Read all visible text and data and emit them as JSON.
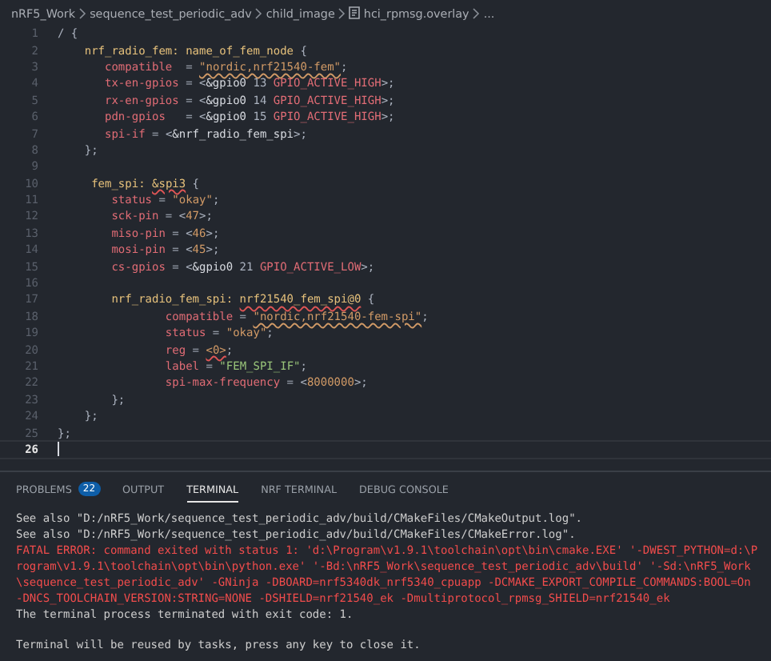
{
  "breadcrumb": [
    {
      "text": "nRF5_Work",
      "kind": "folder"
    },
    {
      "text": "sequence_test_periodic_adv",
      "kind": "folder"
    },
    {
      "text": "child_image",
      "kind": "folder"
    },
    {
      "text": "hci_rpmsg.overlay",
      "kind": "file"
    },
    {
      "text": "...",
      "kind": "more"
    }
  ],
  "editor": {
    "lines": [
      {
        "number": "1",
        "current": false,
        "tokens": [
          {
            "text": "/ {",
            "kind": "punct"
          }
        ]
      },
      {
        "number": "2",
        "current": false,
        "tokens": [
          {
            "text": "    nrf_radio_fem: name_of_fem_node",
            "kind": "node"
          },
          {
            "text": " {",
            "kind": "punct"
          }
        ]
      },
      {
        "number": "3",
        "current": false,
        "tokens": [
          {
            "text": "       compatible",
            "kind": "key"
          },
          {
            "text": "  = ",
            "kind": "punct"
          },
          {
            "text": "\"nordic,nrf21540-fem\"",
            "kind": "string",
            "warning": true
          },
          {
            "text": ";",
            "kind": "punct"
          }
        ]
      },
      {
        "number": "4",
        "current": false,
        "tokens": [
          {
            "text": "       tx-en-gpios",
            "kind": "key"
          },
          {
            "text": " = <",
            "kind": "punct"
          },
          {
            "text": "&gpio0",
            "kind": "ref"
          },
          {
            "text": " 13 ",
            "kind": "punct"
          },
          {
            "text": "GPIO_ACTIVE_HIGH",
            "kind": "const"
          },
          {
            "text": ">;",
            "kind": "punct"
          }
        ]
      },
      {
        "number": "5",
        "current": false,
        "tokens": [
          {
            "text": "       rx-en-gpios",
            "kind": "key"
          },
          {
            "text": " = <",
            "kind": "punct"
          },
          {
            "text": "&gpio0",
            "kind": "ref"
          },
          {
            "text": " 14 ",
            "kind": "punct"
          },
          {
            "text": "GPIO_ACTIVE_HIGH",
            "kind": "const"
          },
          {
            "text": ">;",
            "kind": "punct"
          }
        ]
      },
      {
        "number": "6",
        "current": false,
        "tokens": [
          {
            "text": "       pdn-gpios",
            "kind": "key"
          },
          {
            "text": "   = <",
            "kind": "punct"
          },
          {
            "text": "&gpio0",
            "kind": "ref"
          },
          {
            "text": " 15 ",
            "kind": "punct"
          },
          {
            "text": "GPIO_ACTIVE_HIGH",
            "kind": "const"
          },
          {
            "text": ">;",
            "kind": "punct"
          }
        ]
      },
      {
        "number": "7",
        "current": false,
        "tokens": [
          {
            "text": "       spi-if",
            "kind": "key"
          },
          {
            "text": " = <",
            "kind": "punct"
          },
          {
            "text": "&nrf_radio_fem_spi",
            "kind": "ref"
          },
          {
            "text": ">;",
            "kind": "punct"
          }
        ]
      },
      {
        "number": "8",
        "current": false,
        "tokens": [
          {
            "text": "    };",
            "kind": "punct"
          }
        ]
      },
      {
        "number": "9",
        "current": false
      },
      {
        "number": "10",
        "current": false,
        "tokens": [
          {
            "text": "     fem_spi: ",
            "kind": "node"
          },
          {
            "text": "&spi3",
            "kind": "node",
            "error": true
          },
          {
            "text": " {",
            "kind": "punct"
          }
        ]
      },
      {
        "number": "11",
        "current": false,
        "tokens": [
          {
            "text": "        status",
            "kind": "key"
          },
          {
            "text": " = ",
            "kind": "punct"
          },
          {
            "text": "\"okay\"",
            "kind": "string"
          },
          {
            "text": ";",
            "kind": "punct"
          }
        ]
      },
      {
        "number": "12",
        "current": false,
        "tokens": [
          {
            "text": "        sck-pin",
            "kind": "key"
          },
          {
            "text": " = <",
            "kind": "punct"
          },
          {
            "text": "47",
            "kind": "number"
          },
          {
            "text": ">;",
            "kind": "punct"
          }
        ]
      },
      {
        "number": "13",
        "current": false,
        "tokens": [
          {
            "text": "        miso-pin",
            "kind": "key"
          },
          {
            "text": " = <",
            "kind": "punct"
          },
          {
            "text": "46",
            "kind": "number"
          },
          {
            "text": ">;",
            "kind": "punct"
          }
        ]
      },
      {
        "number": "14",
        "current": false,
        "tokens": [
          {
            "text": "        mosi-pin",
            "kind": "key"
          },
          {
            "text": " = <",
            "kind": "punct"
          },
          {
            "text": "45",
            "kind": "number"
          },
          {
            "text": ">;",
            "kind": "punct"
          }
        ]
      },
      {
        "number": "15",
        "current": false,
        "tokens": [
          {
            "text": "        cs-gpios",
            "kind": "key"
          },
          {
            "text": " = <",
            "kind": "punct"
          },
          {
            "text": "&gpio0",
            "kind": "ref"
          },
          {
            "text": " 21 ",
            "kind": "punct"
          },
          {
            "text": "GPIO_ACTIVE_LOW",
            "kind": "const"
          },
          {
            "text": ">;",
            "kind": "punct"
          }
        ]
      },
      {
        "number": "16",
        "current": false
      },
      {
        "number": "17",
        "current": false,
        "tokens": [
          {
            "text": "        nrf_radio_fem_spi: ",
            "kind": "node"
          },
          {
            "text": "nrf21540_fem_spi@0",
            "kind": "node",
            "error": true
          },
          {
            "text": " {",
            "kind": "punct"
          }
        ]
      },
      {
        "number": "18",
        "current": false,
        "tokens": [
          {
            "text": "                compatible",
            "kind": "key"
          },
          {
            "text": " = ",
            "kind": "punct"
          },
          {
            "text": "\"nordic,nrf21540-fem-spi\"",
            "kind": "string",
            "warning": true
          },
          {
            "text": ";",
            "kind": "punct"
          }
        ]
      },
      {
        "number": "19",
        "current": false,
        "tokens": [
          {
            "text": "                status",
            "kind": "key"
          },
          {
            "text": " = ",
            "kind": "punct"
          },
          {
            "text": "\"okay\"",
            "kind": "string"
          },
          {
            "text": ";",
            "kind": "punct"
          }
        ]
      },
      {
        "number": "20",
        "current": false,
        "tokens": [
          {
            "text": "                reg",
            "kind": "key"
          },
          {
            "text": " = ",
            "kind": "punct"
          },
          {
            "text": "<0>",
            "kind": "number",
            "error": true
          },
          {
            "text": ";",
            "kind": "punct"
          }
        ]
      },
      {
        "number": "21",
        "current": false,
        "tokens": [
          {
            "text": "                label",
            "kind": "key"
          },
          {
            "text": " = ",
            "kind": "punct"
          },
          {
            "text": "\"FEM_SPI_IF\"",
            "kind": "label"
          },
          {
            "text": ";",
            "kind": "punct"
          }
        ]
      },
      {
        "number": "22",
        "current": false,
        "tokens": [
          {
            "text": "                spi-max-frequency",
            "kind": "key"
          },
          {
            "text": " = <",
            "kind": "punct"
          },
          {
            "text": "8000000",
            "kind": "number"
          },
          {
            "text": ">;",
            "kind": "punct"
          }
        ]
      },
      {
        "number": "23",
        "current": false,
        "tokens": [
          {
            "text": "        };",
            "kind": "punct"
          }
        ]
      },
      {
        "number": "24",
        "current": false,
        "tokens": [
          {
            "text": "    };",
            "kind": "punct"
          }
        ]
      },
      {
        "number": "25",
        "current": false,
        "tokens": [
          {
            "text": "};",
            "kind": "punct"
          }
        ]
      },
      {
        "number": "26",
        "current": true
      }
    ]
  },
  "panel": {
    "tabs": [
      {
        "label": "PROBLEMS",
        "badge": "22",
        "selected": false
      },
      {
        "label": "OUTPUT",
        "selected": false
      },
      {
        "label": "TERMINAL",
        "selected": true
      },
      {
        "label": "NRF TERMINAL",
        "selected": false
      },
      {
        "label": "DEBUG CONSOLE",
        "selected": false
      }
    ],
    "terminal": [
      {
        "kind": "normal",
        "text": "See also \"D:/nRF5_Work/sequence_test_periodic_adv/build/CMakeFiles/CMakeOutput.log\"."
      },
      {
        "kind": "normal",
        "text": "See also \"D:/nRF5_Work/sequence_test_periodic_adv/build/CMakeFiles/CMakeError.log\"."
      },
      {
        "kind": "error",
        "text": "FATAL ERROR: command exited with status 1: 'd:\\Program\\v1.9.1\\toolchain\\opt\\bin\\cmake.EXE' '-DWEST_PYTHON=d:\\Program\\v1.9.1\\toolchain\\opt\\bin\\python.exe' '-Bd:\\nRF5_Work\\sequence_test_periodic_adv\\build' '-Sd:\\nRF5_Work\\sequence_test_periodic_adv' -GNinja -DBOARD=nrf5340dk_nrf5340_cpuapp -DCMAKE_EXPORT_COMPILE_COMMANDS:BOOL=On -DNCS_TOOLCHAIN_VERSION:STRING=NONE -DSHIELD=nrf21540_ek -Dmultiprotocol_rpmsg_SHIELD=nrf21540_ek"
      },
      {
        "kind": "normal",
        "text": "The terminal process terminated with exit code: 1."
      },
      {
        "kind": "notice",
        "text": "Terminal will be reused by tasks, press any key to close it."
      }
    ]
  }
}
